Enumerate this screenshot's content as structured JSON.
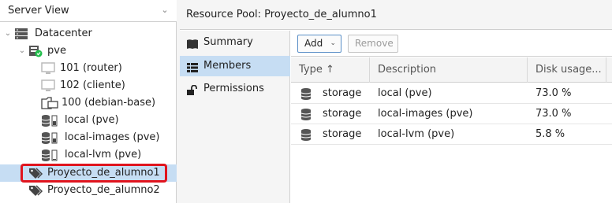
{
  "left_panel": {
    "view_select": "Server View",
    "tree": [
      {
        "label": "Datacenter",
        "icon": "datacenter-icon"
      },
      {
        "label": "pve",
        "icon": "node-online-icon"
      },
      {
        "label": "101 (router)",
        "icon": "vm-icon"
      },
      {
        "label": "102 (cliente)",
        "icon": "vm-icon"
      },
      {
        "label": "100 (debian-base)",
        "icon": "template-icon"
      },
      {
        "label": "local (pve)",
        "icon": "storage-icon"
      },
      {
        "label": "local-images (pve)",
        "icon": "storage-icon"
      },
      {
        "label": "local-lvm (pve)",
        "icon": "storage-icon"
      },
      {
        "label": "Proyecto_de_alumno1",
        "icon": "tags-icon",
        "selected": true
      },
      {
        "label": "Proyecto_de_alumno2",
        "icon": "tags-icon"
      }
    ]
  },
  "main": {
    "title": "Resource Pool: Proyecto_de_alumno1",
    "nav": [
      {
        "label": "Summary",
        "icon": "book-icon"
      },
      {
        "label": "Members",
        "icon": "grid-icon",
        "active": true
      },
      {
        "label": "Permissions",
        "icon": "unlock-icon"
      }
    ],
    "toolbar": {
      "add_label": "Add",
      "remove_label": "Remove"
    },
    "grid": {
      "columns": [
        "Type ↑",
        "Description",
        "Disk usage..."
      ],
      "rows": [
        {
          "type": "storage",
          "description": "local (pve)",
          "disk_usage": "73.0 %"
        },
        {
          "type": "storage",
          "description": "local-images (pve)",
          "disk_usage": "73.0 %"
        },
        {
          "type": "storage",
          "description": "local-lvm (pve)",
          "disk_usage": "5.8 %"
        }
      ]
    }
  },
  "colors": {
    "selection": "#c6ddf3",
    "highlight_border": "#e0141e",
    "online_badge": "#21bf4b"
  }
}
